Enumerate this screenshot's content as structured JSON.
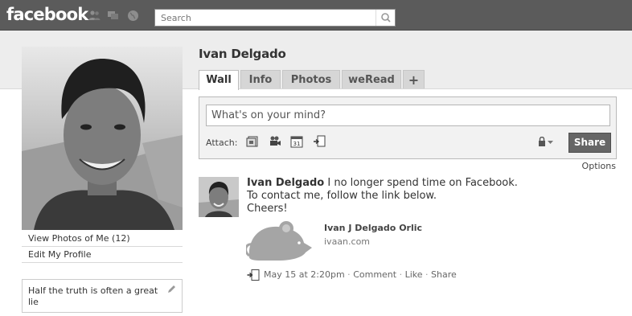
{
  "header": {
    "logo": "facebook",
    "search_placeholder": "Search"
  },
  "profile": {
    "name": "Ivan Delgado",
    "view_photos": "View Photos of Me (12)",
    "edit_profile": "Edit My Profile",
    "bio": "Half the truth is often a great lie"
  },
  "tabs": [
    {
      "label": "Wall"
    },
    {
      "label": "Info"
    },
    {
      "label": "Photos"
    },
    {
      "label": "weRead"
    },
    {
      "label": "+"
    }
  ],
  "composer": {
    "placeholder": "What's on your mind?",
    "attach_label": "Attach:",
    "attach_icons": [
      "photo-icon",
      "video-icon",
      "event-icon",
      "link-icon"
    ],
    "share_label": "Share"
  },
  "options_label": "Options",
  "post": {
    "author": "Ivan Delgado",
    "line1": " I no longer spend time on Facebook.",
    "line2": "To contact me, follow the link below.",
    "line3": "Cheers!",
    "link_title": "Ivan J Delgado Orlic",
    "link_domain": "ivaan.com",
    "timestamp": "May 15 at 2:20pm",
    "comment": "Comment",
    "like": "Like",
    "share": "Share",
    "separator": " · "
  }
}
